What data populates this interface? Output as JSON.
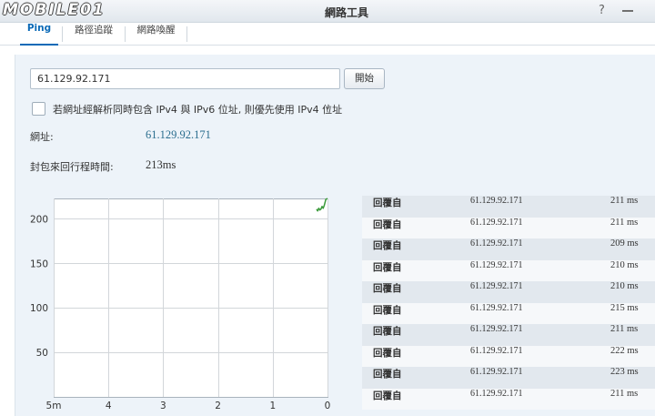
{
  "logo": "MOBILE01",
  "window": {
    "title": "網路工具",
    "help_icon": "help-icon",
    "minimize_icon": "minimize-icon"
  },
  "tabs": [
    {
      "label": "Ping",
      "active": true
    },
    {
      "label": "路徑追蹤",
      "active": false
    },
    {
      "label": "網路喚醒",
      "active": false
    }
  ],
  "ping": {
    "target_input": {
      "value": "61.129.92.171"
    },
    "start_button": "開始",
    "prefer_ipv4": {
      "checked": false,
      "label": "若網址經解析同時包含 IPv4 與 IPv6 位址, 則優先使用 IPv4 位址",
      "hint_icon": "caret-down-icon"
    },
    "address_label": "網址:",
    "address_value": "61.129.92.171",
    "rtt_label": "封包來回行程時間:",
    "rtt_value": "213ms"
  },
  "colors": {
    "accent": "#0b6ab7",
    "panel_background": "#edf3f9",
    "address_value": "#2a6d8e"
  },
  "chart_data": {
    "type": "line",
    "x_ticks": [
      5,
      4,
      3,
      2,
      1,
      0
    ],
    "x_tick_labels": [
      "5m",
      "4",
      "3",
      "2",
      "1",
      "0"
    ],
    "y_ticks": [
      200,
      150,
      100,
      50
    ],
    "y_tick_labels": [
      "200",
      "150",
      "100",
      "50"
    ],
    "xlim": [
      5,
      0
    ],
    "ylim": [
      0,
      223
    ],
    "grid": true,
    "series": [
      {
        "x": [
          0.2,
          0.18,
          0.16,
          0.14,
          0.12,
          0.1,
          0.08,
          0.06,
          0.03,
          0
        ],
        "values": [
          211,
          209,
          212,
          210,
          211,
          214,
          212,
          215,
          222,
          223
        ],
        "color": "#3a9a3a"
      }
    ]
  },
  "replies": [
    {
      "label": "回覆自",
      "ip": "61.129.92.171",
      "time": "211 ms"
    },
    {
      "label": "回覆自",
      "ip": "61.129.92.171",
      "time": "211 ms"
    },
    {
      "label": "回覆自",
      "ip": "61.129.92.171",
      "time": "209 ms"
    },
    {
      "label": "回覆自",
      "ip": "61.129.92.171",
      "time": "210 ms"
    },
    {
      "label": "回覆自",
      "ip": "61.129.92.171",
      "time": "210 ms"
    },
    {
      "label": "回覆自",
      "ip": "61.129.92.171",
      "time": "215 ms"
    },
    {
      "label": "回覆自",
      "ip": "61.129.92.171",
      "time": "211 ms"
    },
    {
      "label": "回覆自",
      "ip": "61.129.92.171",
      "time": "222 ms"
    },
    {
      "label": "回覆自",
      "ip": "61.129.92.171",
      "time": "223 ms"
    },
    {
      "label": "回覆自",
      "ip": "61.129.92.171",
      "time": "211 ms"
    }
  ]
}
